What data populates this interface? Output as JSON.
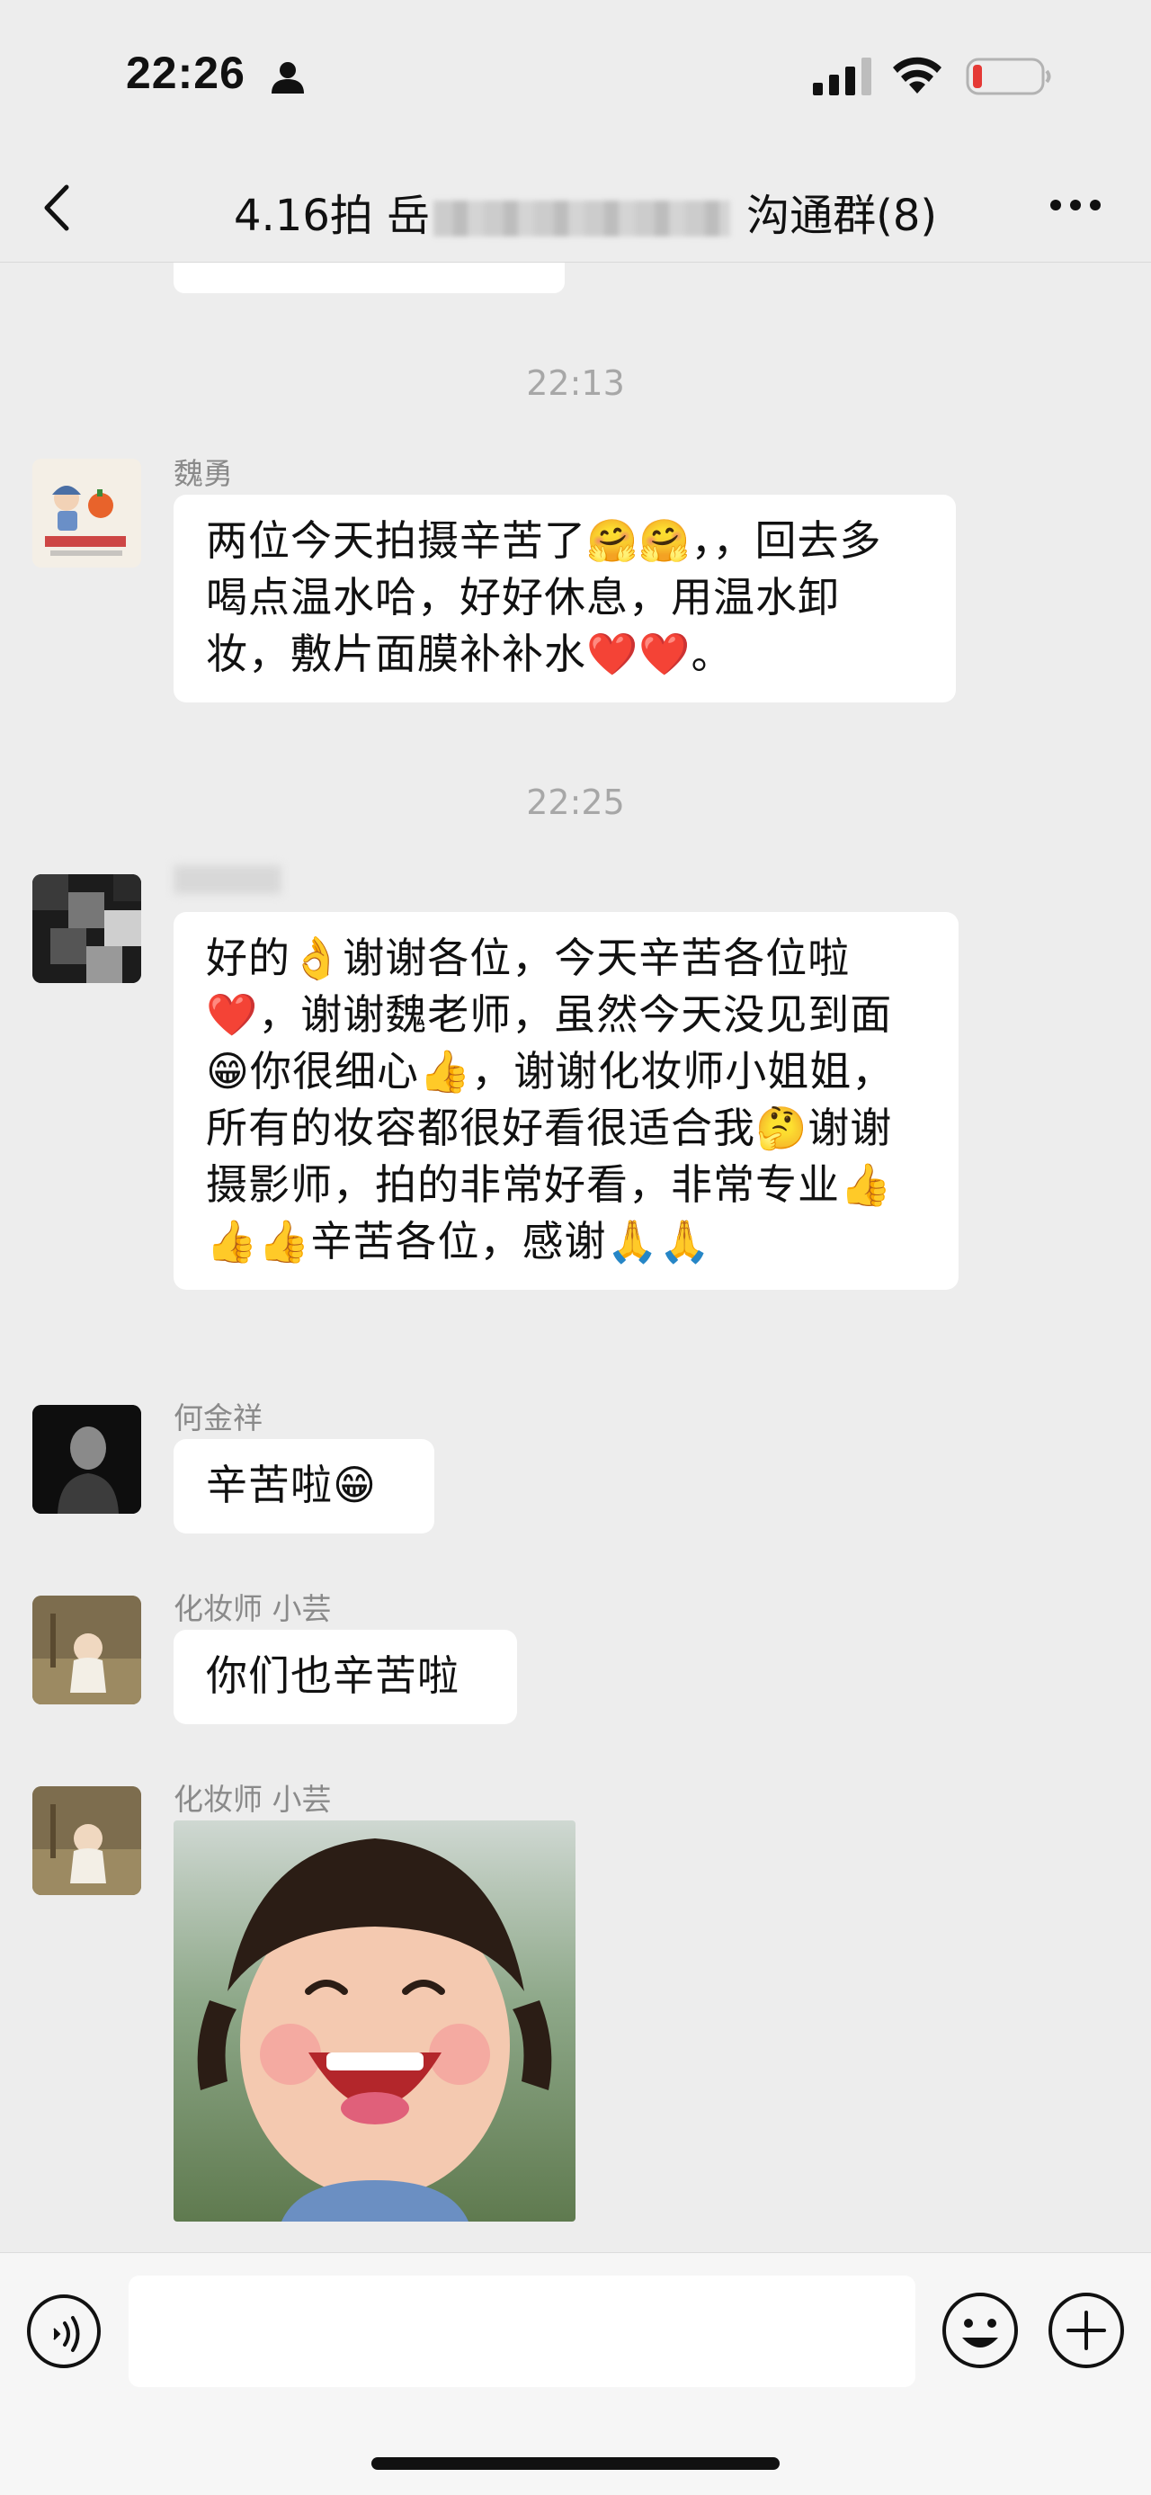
{
  "status_bar": {
    "time": "22:26",
    "icons": [
      "person-icon",
      "signal-icon",
      "wifi-icon",
      "battery-low-icon"
    ]
  },
  "nav": {
    "title_prefix": "4.16拍 岳",
    "title_suffix": "沟通群(8)",
    "back_icon": "chevron-left-icon",
    "more_icon": "ellipsis-icon"
  },
  "timestamps": [
    "22:13",
    "22:25"
  ],
  "messages": [
    {
      "sender": "魏勇",
      "text": "两位今天拍摄辛苦了🤗🤗，，回去多喝点温水哈，好好休息，用温水卸妆，敷片面膜补补水❤️❤️。"
    },
    {
      "sender": "",
      "text": "好的👌谢谢各位，今天辛苦各位啦❤️，谢谢魏老师，虽然今天没见到面😁你很细心👍，谢谢化妆师小姐姐，所有的妆容都很好看很适合我🤔谢谢摄影师，拍的非常好看，非常专业👍👍👍辛苦各位，感谢🙏🙏"
    },
    {
      "sender": "何金祥",
      "text": "辛苦啦😁"
    },
    {
      "sender": "化妆师  小芸",
      "text": "你们也辛苦啦"
    },
    {
      "sender": "化妆师  小芸",
      "image": "laughing-toddler-sticker"
    }
  ],
  "bottom_bar": {
    "icons": [
      "voice-icon",
      "emoji-icon",
      "plus-icon"
    ],
    "input_value": ""
  },
  "colors": {
    "background": "#ededed",
    "bubble": "#ffffff",
    "timestamp": "#a7a7a7",
    "sender": "#8a8a8a",
    "battery_low": "#e53935"
  }
}
